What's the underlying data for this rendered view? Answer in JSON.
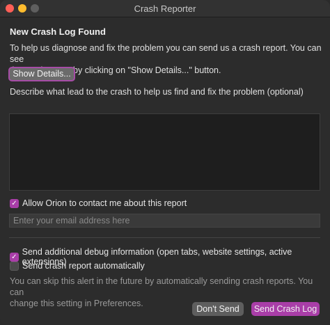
{
  "window": {
    "title": "Crash Reporter"
  },
  "heading": "New Crash Log Found",
  "description_line1": "To help us diagnose and fix the problem you can send us a crash report. You can see",
  "description_line2": "the crash report by clicking on \"Show Details...\" button.",
  "show_details_label": "Show Details...",
  "prompt": "Describe what lead to the crash to help us find and fix the problem (optional)",
  "allow_contact": {
    "label": "Allow Orion to contact me about this report",
    "checked": true
  },
  "email": {
    "placeholder": "Enter your email address here",
    "value": ""
  },
  "send_debug": {
    "label": "Send additional debug information (open tabs, website settings, active extensions)",
    "checked": true
  },
  "send_auto": {
    "label": "Send crash report automatically",
    "checked": false
  },
  "note_line1": "You can skip this alert in the future by automatically sending crash reports. You can",
  "note_line2": "change this setting in Preferences.",
  "buttons": {
    "dont_send": "Don't Send",
    "send": "Send Crash Log"
  },
  "colors": {
    "accent": "#a93ea8",
    "background": "#2c2c2c"
  }
}
